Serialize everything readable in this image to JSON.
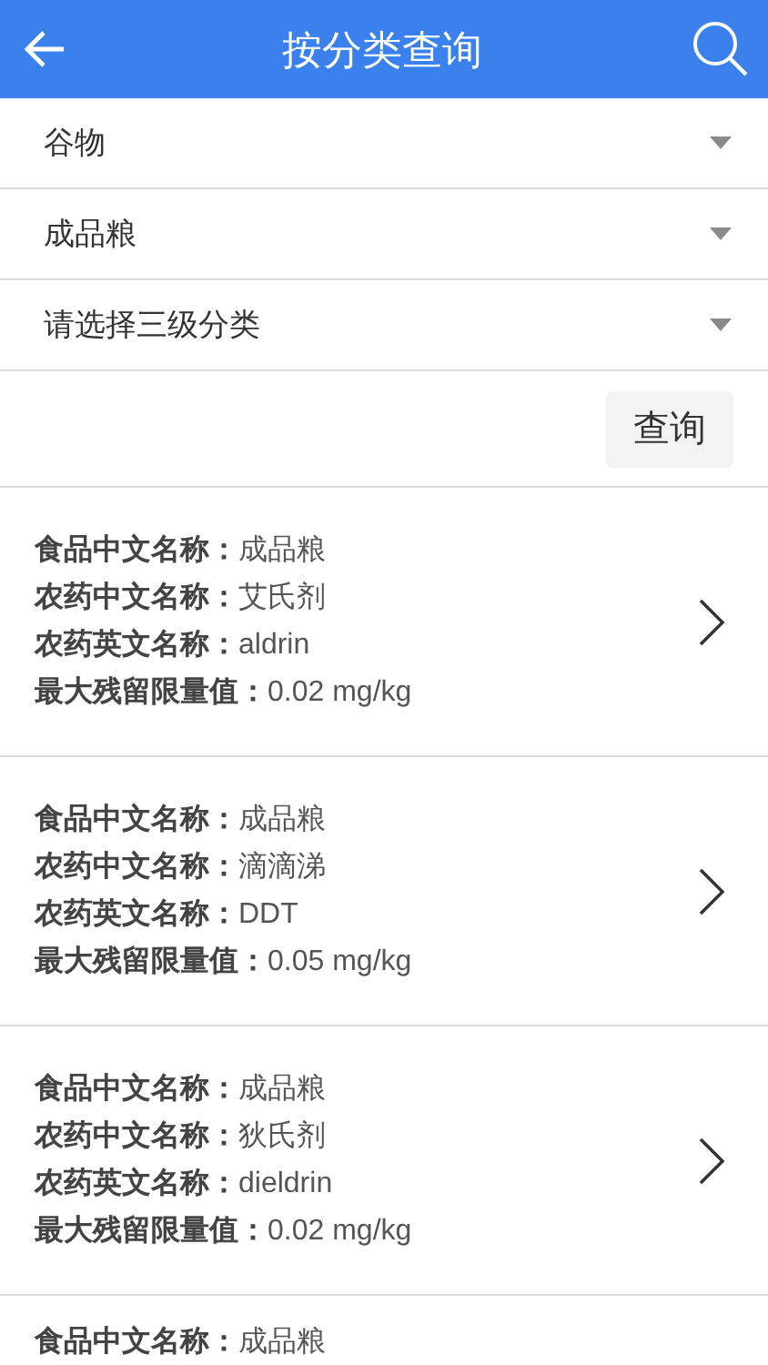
{
  "header": {
    "title": "按分类查询"
  },
  "dropdowns": [
    {
      "value": "谷物"
    },
    {
      "value": "成品粮"
    },
    {
      "value": "请选择三级分类"
    }
  ],
  "query_button": "查询",
  "results": [
    {
      "lines": [
        "**食品中文名称：**成品粮",
        "**农药中文名称：**艾氏剂",
        "**农药英文名称：**aldrin",
        "**最大残留限量值：**0.02 mg/kg"
      ],
      "cut": false
    },
    {
      "lines": [
        "**食品中文名称：**成品粮",
        "**农药中文名称：**滴滴涕",
        "**农药英文名称：**DDT",
        "**最大残留限量值：**0.05 mg/kg"
      ],
      "cut": false
    },
    {
      "lines": [
        "**食品中文名称：**成品粮",
        "**农药中文名称：**狄氏剂",
        "**农药英文名称：**dieldrin",
        "**最大残留限量值：**0.02 mg/kg"
      ],
      "cut": false
    },
    {
      "lines": [
        "**食品中文名称：**成品粮"
      ],
      "cut": true
    }
  ]
}
